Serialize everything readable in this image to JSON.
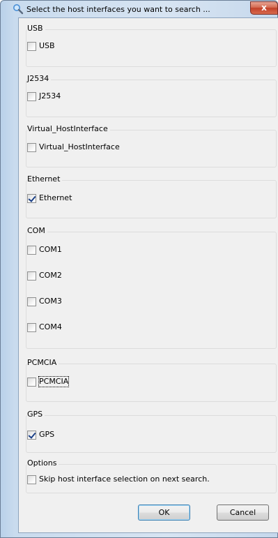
{
  "window": {
    "title": "Select the host interfaces you want to search ...",
    "close_label": "x"
  },
  "groups": {
    "usb": {
      "title": "USB",
      "items": [
        {
          "label": "USB",
          "checked": false
        }
      ]
    },
    "j2534": {
      "title": "J2534",
      "items": [
        {
          "label": "J2534",
          "checked": false
        }
      ]
    },
    "virtual": {
      "title": "Virtual_HostInterface",
      "items": [
        {
          "label": "Virtual_HostInterface",
          "checked": false
        }
      ]
    },
    "ethernet": {
      "title": "Ethernet",
      "items": [
        {
          "label": "Ethernet",
          "checked": true
        }
      ]
    },
    "com": {
      "title": "COM",
      "items": [
        {
          "label": "COM1",
          "checked": false
        },
        {
          "label": "COM2",
          "checked": false
        },
        {
          "label": "COM3",
          "checked": false
        },
        {
          "label": "COM4",
          "checked": false
        }
      ]
    },
    "pcmcia": {
      "title": "PCMCIA",
      "items": [
        {
          "label": "PCMCIA",
          "checked": false
        }
      ]
    },
    "gps": {
      "title": "GPS",
      "items": [
        {
          "label": "GPS",
          "checked": true
        }
      ]
    },
    "options": {
      "title": "Options",
      "items": [
        {
          "label": "Skip host interface selection on next search.",
          "checked": false
        }
      ]
    }
  },
  "buttons": {
    "ok": "OK",
    "cancel": "Cancel"
  },
  "icons": {
    "title": "search-icon",
    "close": "close-icon"
  },
  "colors": {
    "close_button": "#c2412a",
    "check_mark": "#1a3f86",
    "client_bg": "#f0f0f0"
  }
}
